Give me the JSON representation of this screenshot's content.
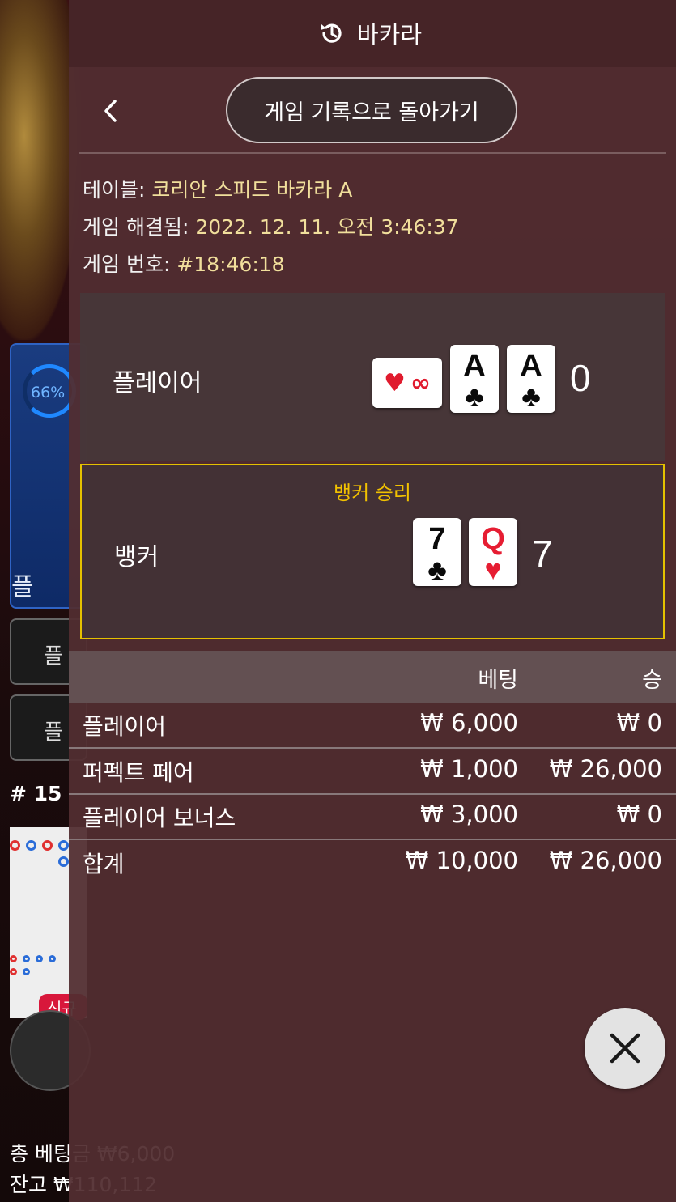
{
  "background": {
    "player_pct": "66%",
    "player_tile_char": "플",
    "btn1": "플",
    "btn2": "플",
    "round": "# 15",
    "new_badge": "신규",
    "total_bet": "총 베팅금 ₩6,000",
    "balance": "잔고 ₩110,112"
  },
  "header": {
    "title": "바카라",
    "history_icon": "history-icon"
  },
  "nav": {
    "back_icon": "chevron-left-icon",
    "back_to_history": "게임 기록으로 돌아가기"
  },
  "info": {
    "table_label": "테이블:",
    "table_value": "코리안 스피드 바카라 A",
    "resolved_label": "게임 해결됨:",
    "resolved_value": "2022. 12. 11. 오전 3:46:37",
    "number_label": "게임 번호:",
    "number_value": "#18:46:18"
  },
  "player": {
    "label": "플레이어",
    "side_card": {
      "suit": "♥",
      "symbol": "∞"
    },
    "cards": [
      {
        "rank": "A",
        "suit": "♣",
        "color": "black"
      },
      {
        "rank": "A",
        "suit": "♣",
        "color": "black"
      }
    ],
    "score": "0"
  },
  "banker": {
    "label": "뱅커",
    "winner": "뱅커 승리",
    "cards": [
      {
        "rank": "7",
        "suit": "♣",
        "color": "black"
      },
      {
        "rank": "Q",
        "suit": "♥",
        "color": "red"
      }
    ],
    "score": "7"
  },
  "bets": {
    "col_bet": "베팅",
    "col_win": "승",
    "rows": [
      {
        "name": "플레이어",
        "bet": "₩ 6,000",
        "win": "₩ 0"
      },
      {
        "name": "퍼펙트 페어",
        "bet": "₩ 1,000",
        "win": "₩ 26,000"
      },
      {
        "name": "플레이어 보너스",
        "bet": "₩ 3,000",
        "win": "₩ 0"
      }
    ],
    "total": {
      "name": "합계",
      "bet": "₩ 10,000",
      "win": "₩ 26,000"
    }
  },
  "close_icon": "close-icon",
  "colors": {
    "accent_gold": "#e5c100",
    "value_text": "#f1df9c",
    "panel": "#522e31"
  }
}
